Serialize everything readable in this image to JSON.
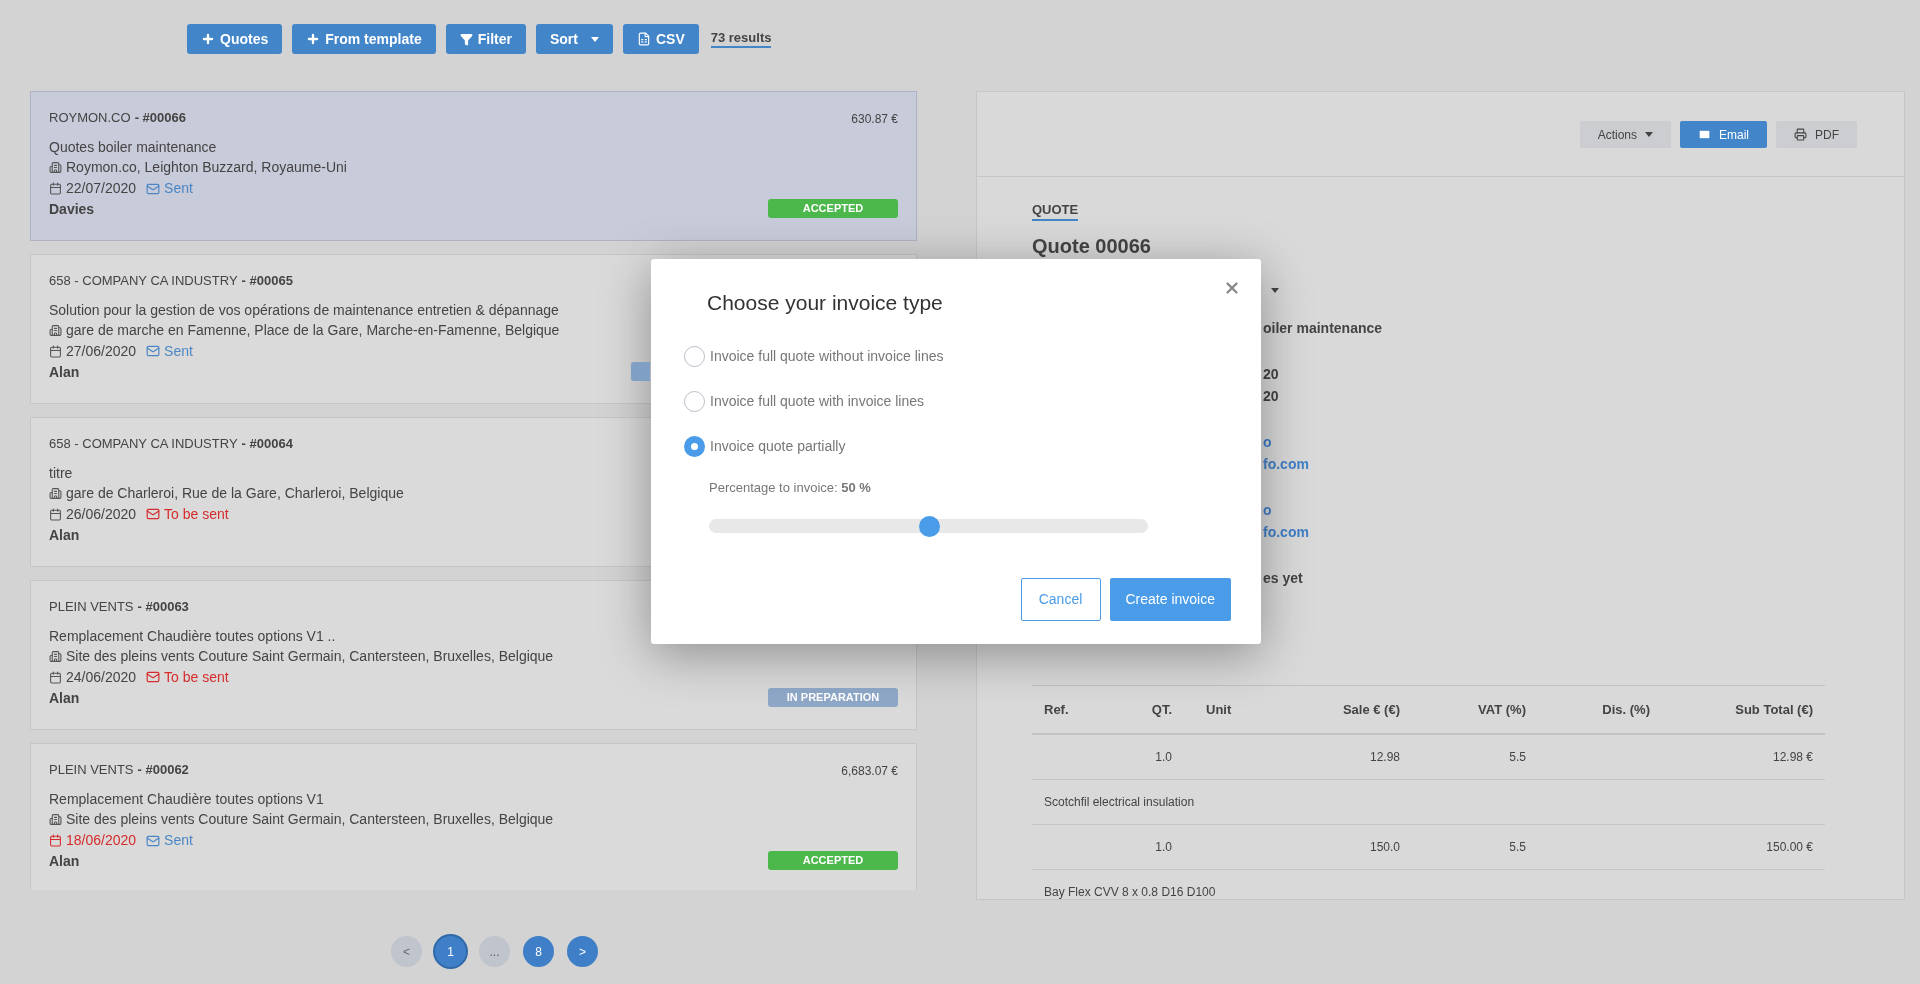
{
  "toolbar": {
    "buttons": [
      {
        "label": "Quotes",
        "kind": "plus"
      },
      {
        "label": "From template",
        "kind": "plus"
      },
      {
        "label": "Filter",
        "kind": "filter"
      },
      {
        "label": "Sort",
        "kind": "dropdown"
      },
      {
        "label": "CSV",
        "kind": "file"
      }
    ],
    "results": "73 results"
  },
  "quotes": [
    {
      "client": "ROYMON.CO",
      "number": "- #00066",
      "amount": "630.87 €",
      "selected": true,
      "title": "Quotes boiler maintenance",
      "address": "Roymon.co, Leighton Buzzard, Royaume-Uni",
      "date": "22/07/2020",
      "overdue": false,
      "mail": {
        "label": "Sent",
        "kind": "sent"
      },
      "author": "Davies",
      "badge": {
        "label": "ACCEPTED",
        "color": "#4cb84c"
      }
    },
    {
      "client": "658 - COMPANY CA INDUSTRY",
      "number": "- #00065",
      "selected": false,
      "title": "Solution pour la gestion de vos opérations de maintenance entretien & dépannage",
      "address": "gare de marche en Famenne, Place de la Gare, Marche-en-Famenne, Belgique",
      "date": "27/06/2020",
      "overdue": false,
      "mail": {
        "label": "Sent",
        "kind": "sent"
      },
      "author": "Alan",
      "badge": {
        "color": "#7f9fc4"
      }
    },
    {
      "client": "658 - COMPANY CA INDUSTRY",
      "number": "- #00064",
      "selected": false,
      "title": "titre",
      "address": "gare de Charleroi, Rue de la Gare, Charleroi, Belgique",
      "date": "26/06/2020",
      "overdue": false,
      "mail": {
        "label": "To be sent",
        "kind": "pending"
      },
      "author": "Alan"
    },
    {
      "client": "PLEIN VENTS",
      "number": "- #00063",
      "selected": false,
      "title": "Remplacement Chaudière toutes options V1 ..",
      "address": "Site des pleins vents Couture Saint Germain, Cantersteen, Bruxelles, Belgique",
      "date": "24/06/2020",
      "overdue": false,
      "mail": {
        "label": "To be sent",
        "kind": "pending"
      },
      "author": "Alan",
      "badge": {
        "label": "IN PREPARATION",
        "color": "#8fa8c8"
      }
    },
    {
      "client": "PLEIN VENTS",
      "number": "- #00062",
      "amount": "6,683.07 €",
      "selected": false,
      "title": "Remplacement Chaudière toutes options V1",
      "address": "Site des pleins vents Couture Saint Germain, Cantersteen, Bruxelles, Belgique",
      "date": "18/06/2020",
      "overdue": true,
      "mail": {
        "label": "Sent",
        "kind": "sent"
      },
      "author": "Alan",
      "badge": {
        "label": "ACCEPTED",
        "color": "#4cb84c"
      }
    }
  ],
  "pagination": [
    {
      "label": "<",
      "selected": false,
      "disabled": true
    },
    {
      "label": "1",
      "selected": true,
      "disabled": false
    },
    {
      "label": "...",
      "selected": false,
      "disabled": true
    },
    {
      "label": "8",
      "selected": false,
      "disabled": false
    },
    {
      "label": ">",
      "selected": false,
      "disabled": false
    }
  ],
  "detail": {
    "actions": [
      {
        "label": "Actions",
        "kind": "dropdown"
      },
      {
        "label": "Email",
        "kind": "email"
      },
      {
        "label": "PDF",
        "kind": "print"
      }
    ],
    "section": "QUOTE",
    "title": "Quote 00066",
    "fragments": [
      [
        {
          "kind": "caret"
        }
      ],
      [
        {
          "text": "oiler maintenance",
          "kind": "bold"
        }
      ],
      [
        {
          "text": "20",
          "kind": "bold"
        },
        {
          "text": "20",
          "kind": "bold"
        }
      ],
      [
        {
          "text": "o",
          "kind": "link"
        },
        {
          "text": "fo.com",
          "kind": "link"
        }
      ],
      [
        {
          "text": "o",
          "kind": "link"
        },
        {
          "text": "fo.com",
          "kind": "link"
        }
      ],
      [
        {
          "text": "es yet",
          "kind": "bold"
        }
      ]
    ],
    "table": {
      "columns": [
        "Ref.",
        "QT.",
        "Unit",
        "Sale € (€)",
        "VAT (%)",
        "Dis. (%)",
        "Sub Total (€)"
      ],
      "rows": [
        {
          "kind": "line",
          "cells": [
            "",
            "1.0",
            "",
            "12.98",
            "5.5",
            "",
            "12.98 €"
          ]
        },
        {
          "kind": "description",
          "text": "Scotchfil electrical insulation"
        },
        {
          "kind": "line",
          "cells": [
            "",
            "1.0",
            "",
            "150.0",
            "5.5",
            "",
            "150.00 €"
          ]
        },
        {
          "kind": "description",
          "text": "Bay Flex CVV 8 x 0.8 D16 D100"
        }
      ]
    }
  },
  "modal": {
    "title": "Choose your invoice type",
    "options": [
      {
        "label": "Invoice full quote without invoice lines",
        "selected": false
      },
      {
        "label": "Invoice full quote with invoice lines",
        "selected": false
      },
      {
        "label": "Invoice quote partially",
        "selected": true
      }
    ],
    "percentage": "Percentage to invoice: **50 %**",
    "slider": {
      "level": 0.5
    },
    "buttons": [
      {
        "label": "Cancel",
        "kind": "secondary"
      },
      {
        "label": "Create invoice",
        "kind": "primary"
      }
    ]
  }
}
